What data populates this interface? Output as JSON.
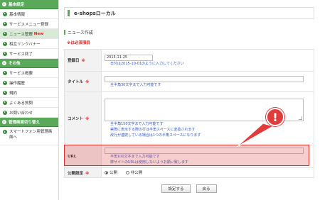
{
  "sidebar": {
    "sections": [
      {
        "header": "基本設定",
        "items": [
          {
            "label": "基本情報"
          },
          {
            "label": "サービスメニュー登録"
          },
          {
            "label": "ニュース管理",
            "badge": "New",
            "active": true
          },
          {
            "label": "相互リンクバナー"
          },
          {
            "label": "サービス終了"
          }
        ]
      },
      {
        "header": "その他",
        "items": [
          {
            "label": "サービス概要"
          },
          {
            "label": "操作履歴"
          },
          {
            "label": "規約"
          },
          {
            "label": "よくある質問"
          },
          {
            "label": "お問い合わせ"
          }
        ]
      },
      {
        "header": "管理画面切り替え",
        "items": [
          {
            "label": "スマートフォン用管理画面へ"
          }
        ]
      }
    ]
  },
  "header": {
    "title": "e-shopsローカル"
  },
  "form": {
    "section_title": "ニュース作成",
    "required_note": "※は必須項目",
    "rows": {
      "date": {
        "label": "登録日",
        "required_mark": "※",
        "value": "2015-11-25",
        "hint": "日付は2015-10-01のように入力してください"
      },
      "title": {
        "label": "タイトル",
        "required_mark": "※",
        "value": "",
        "hint": "全半角30文字まで入力可能です"
      },
      "comment": {
        "label": "コメント",
        "required_mark": "※",
        "value": "",
        "hint1": "全半角150文字まで入力可能です",
        "hint2": "実際に表示する際の行は半角スペースに変換されます",
        "hint3": "改行が連続している場合は1つの半角スペースになります"
      },
      "url": {
        "label": "URL",
        "value": "",
        "hint1": "半角100文字まで入力可能です",
        "hint2": "弊サイトのURLは使用しないようお願い致します"
      },
      "publish": {
        "label": "公開設定",
        "required_mark": "※",
        "option_public": "公開",
        "option_private": "非公開",
        "selected": "公開"
      }
    }
  },
  "buttons": {
    "submit": "設定する",
    "back": "戻る"
  },
  "annotation": {
    "symbol": "!"
  },
  "colors": {
    "accent": "#5aa85a",
    "required": "#e02020",
    "hint": "#3355bb",
    "highlight": "#e03030"
  }
}
